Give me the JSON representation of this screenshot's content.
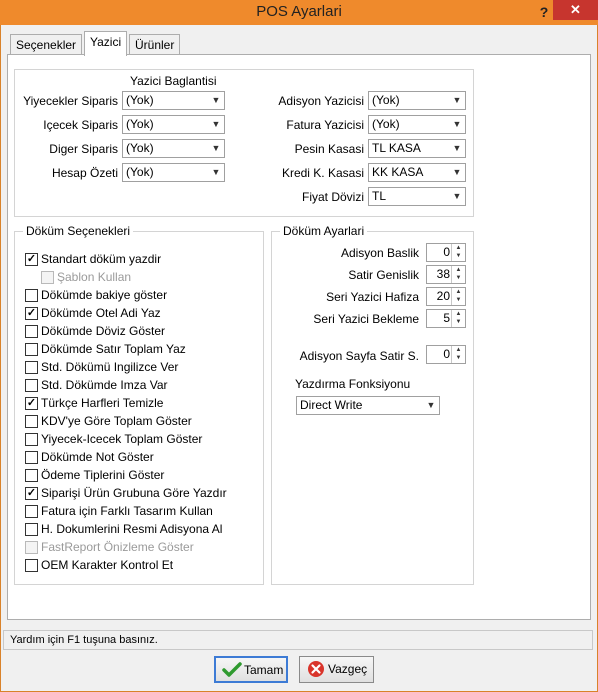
{
  "window": {
    "title": "POS Ayarlari",
    "help_label": "?",
    "close_label": "✕"
  },
  "tabs": [
    "Seçenekler",
    "Yazici",
    "Ürünler"
  ],
  "printer_connection": {
    "title": "Yazici Baglantisi",
    "left": [
      {
        "label": "Yiyecekler Siparis",
        "value": "(Yok)"
      },
      {
        "label": "Içecek Siparis",
        "value": "(Yok)"
      },
      {
        "label": "Diger Siparis",
        "value": "(Yok)"
      },
      {
        "label": "Hesap Özeti",
        "value": "(Yok)"
      }
    ],
    "right": [
      {
        "label": "Adisyon Yazicisi",
        "value": "(Yok)"
      },
      {
        "label": "Fatura Yazicisi",
        "value": "(Yok)"
      },
      {
        "label": "Pesin Kasasi",
        "value": "TL KASA"
      },
      {
        "label": "Kredi K. Kasasi",
        "value": "KK KASA"
      },
      {
        "label": "Fiyat Dövizi",
        "value": "TL"
      }
    ]
  },
  "print_options": {
    "title": "Döküm Seçenekleri",
    "items": [
      {
        "label": "Standart döküm yazdir",
        "checked": true,
        "disabled": false
      },
      {
        "label": "Şablon Kullan",
        "checked": false,
        "disabled": true
      },
      {
        "label": "Dökümde bakiye göster",
        "checked": false,
        "disabled": false
      },
      {
        "label": "Dökümde Otel Adi Yaz",
        "checked": true,
        "disabled": false
      },
      {
        "label": "Dökümde Döviz Göster",
        "checked": false,
        "disabled": false
      },
      {
        "label": "Dökümde Satır Toplam Yaz",
        "checked": false,
        "disabled": false
      },
      {
        "label": "Std. Dökümü Ingilizce Ver",
        "checked": false,
        "disabled": false
      },
      {
        "label": "Std. Dökümde Imza Var",
        "checked": false,
        "disabled": false
      },
      {
        "label": "Türkçe Harfleri Temizle",
        "checked": true,
        "disabled": false
      },
      {
        "label": "KDV'ye Göre Toplam Göster",
        "checked": false,
        "disabled": false
      },
      {
        "label": "Yiyecek-Icecek Toplam Göster",
        "checked": false,
        "disabled": false
      },
      {
        "label": "Dökümde Not Göster",
        "checked": false,
        "disabled": false
      },
      {
        "label": "Ödeme Tiplerini Göster",
        "checked": false,
        "disabled": false
      },
      {
        "label": "Siparişi Ürün Grubuna Göre Yazdır",
        "checked": true,
        "disabled": false
      },
      {
        "label": "Fatura için Farklı Tasarım Kullan",
        "checked": false,
        "disabled": false
      },
      {
        "label": "H. Dokumlerini Resmi Adisyona Al",
        "checked": false,
        "disabled": false
      },
      {
        "label": "FastReport Önizleme Göster",
        "checked": false,
        "disabled": true
      },
      {
        "label": "OEM Karakter Kontrol Et",
        "checked": false,
        "disabled": false
      }
    ]
  },
  "print_settings": {
    "title": "Döküm Ayarlari",
    "spinners": [
      {
        "label": "Adisyon Baslik",
        "value": "0"
      },
      {
        "label": "Satir Genislik",
        "value": "38"
      },
      {
        "label": "Seri Yazici Hafiza",
        "value": "20"
      },
      {
        "label": "Seri Yazici Bekleme",
        "value": "5"
      }
    ],
    "page_rows": {
      "label": "Adisyon Sayfa Satir S.",
      "value": "0"
    },
    "function_label": "Yazdırma Fonksiyonu",
    "function_value": "Direct Write"
  },
  "status_text": "Yardım için F1 tuşuna basınız.",
  "buttons": {
    "ok": "Tamam",
    "cancel": "Vazgeç"
  }
}
